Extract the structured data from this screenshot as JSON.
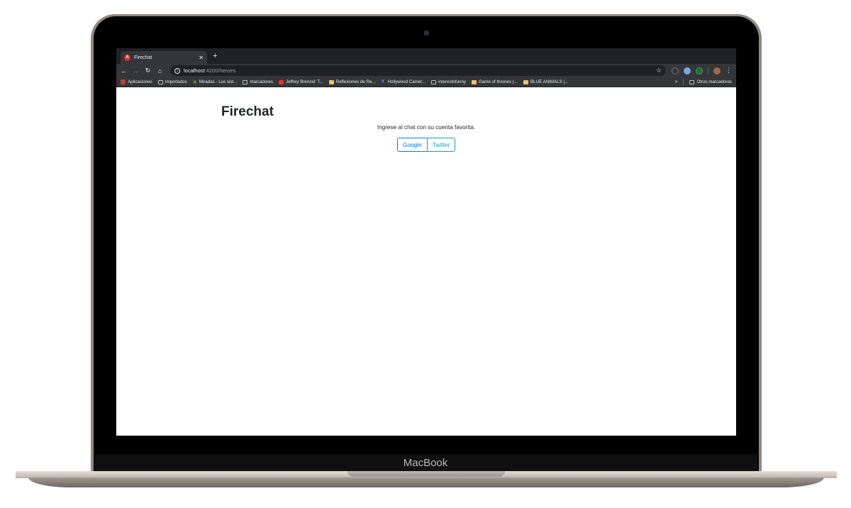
{
  "device": {
    "brand_label": "MacBook"
  },
  "browser": {
    "tab": {
      "title": "Firechat",
      "favicon_letter": "A"
    },
    "new_tab_icon": "+",
    "address": {
      "host": "localhost",
      "path": ":4200/heroes"
    },
    "bookmarks": [
      {
        "icon": "apps-grid-icon",
        "label": "Aplicaciones"
      },
      {
        "icon": "folder-icon",
        "label": "Importados"
      },
      {
        "icon": "x-logo-icon",
        "label": "Miradas - Los sist..."
      },
      {
        "icon": "folder-icon",
        "label": "marcadores"
      },
      {
        "icon": "youtube-icon",
        "label": "Jeffrey Brenzel: T..."
      },
      {
        "icon": "image-icon",
        "label": "Reflexiones de Re..."
      },
      {
        "icon": "y-logo-icon",
        "label": "Hollywood Camer..."
      },
      {
        "icon": "folder-icon",
        "label": "interestnfunny"
      },
      {
        "icon": "image-icon",
        "label": "Game of thrones (..."
      },
      {
        "icon": "image-icon",
        "label": "BLUE ANIMALS |..."
      }
    ],
    "bookmarks_more": "»",
    "other_bookmarks": "Otros marcadores"
  },
  "page": {
    "title": "Firechat",
    "subtitle": "Ingrese al chat con su cuenta favorita.",
    "buttons": {
      "google": "Google",
      "twitter": "Twitter"
    }
  },
  "colors": {
    "google_button": "#007bff",
    "twitter_button": "#17a2b8",
    "chrome_dark": "#35363a"
  }
}
